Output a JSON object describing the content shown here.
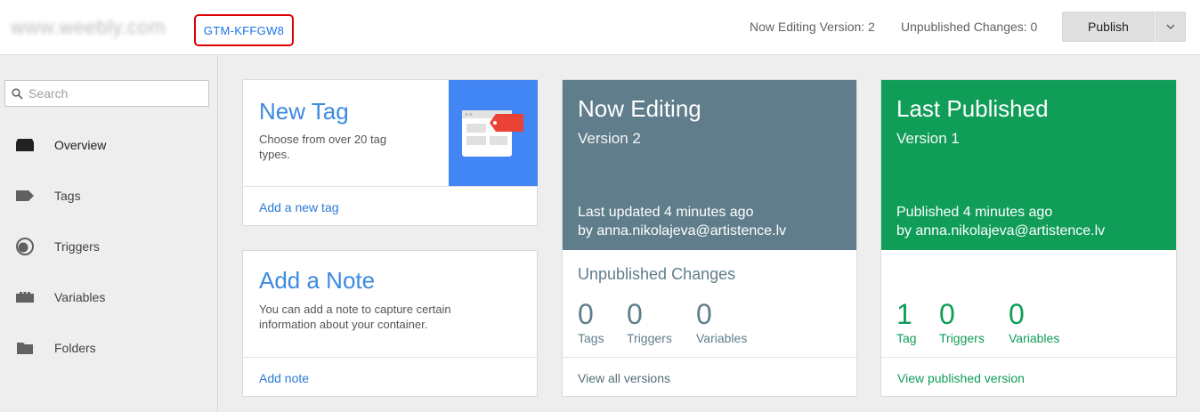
{
  "header": {
    "site_name": "www.weebly.com",
    "container_id": "GTM-KFFGW8",
    "editing_version": "Now Editing Version: 2",
    "unpublished_changes": "Unpublished Changes: 0",
    "publish_label": "Publish"
  },
  "sidebar": {
    "search_placeholder": "Search",
    "items": [
      {
        "label": "Overview",
        "icon": "overview-icon"
      },
      {
        "label": "Tags",
        "icon": "tag-icon"
      },
      {
        "label": "Triggers",
        "icon": "trigger-icon"
      },
      {
        "label": "Variables",
        "icon": "variables-icon"
      },
      {
        "label": "Folders",
        "icon": "folder-icon"
      }
    ]
  },
  "new_tag": {
    "title": "New Tag",
    "description": "Choose from over 20 tag types.",
    "link": "Add a new tag",
    "colors": {
      "banner": "#4285f4",
      "tag": "#ea4335"
    }
  },
  "add_note": {
    "title": "Add a Note",
    "description": "You can add a note to capture certain information about your container.",
    "link": "Add note"
  },
  "now_editing": {
    "title": "Now Editing",
    "version": "Version 2",
    "updated": "Last updated 4 minutes ago",
    "author": "by anna.nikolajeva@artistence.lv",
    "section_title": "Unpublished Changes",
    "stats": [
      {
        "value": "0",
        "label": "Tags"
      },
      {
        "value": "0",
        "label": "Triggers"
      },
      {
        "value": "0",
        "label": "Variables"
      }
    ],
    "link": "View all versions",
    "color": "#607d8b"
  },
  "last_published": {
    "title": "Last Published",
    "version": "Version 1",
    "updated": "Published 4 minutes ago",
    "author": "by anna.nikolajeva@artistence.lv",
    "stats": [
      {
        "value": "1",
        "label": "Tag"
      },
      {
        "value": "0",
        "label": "Triggers"
      },
      {
        "value": "0",
        "label": "Variables"
      }
    ],
    "link": "View published version",
    "color": "#0f9d58"
  }
}
